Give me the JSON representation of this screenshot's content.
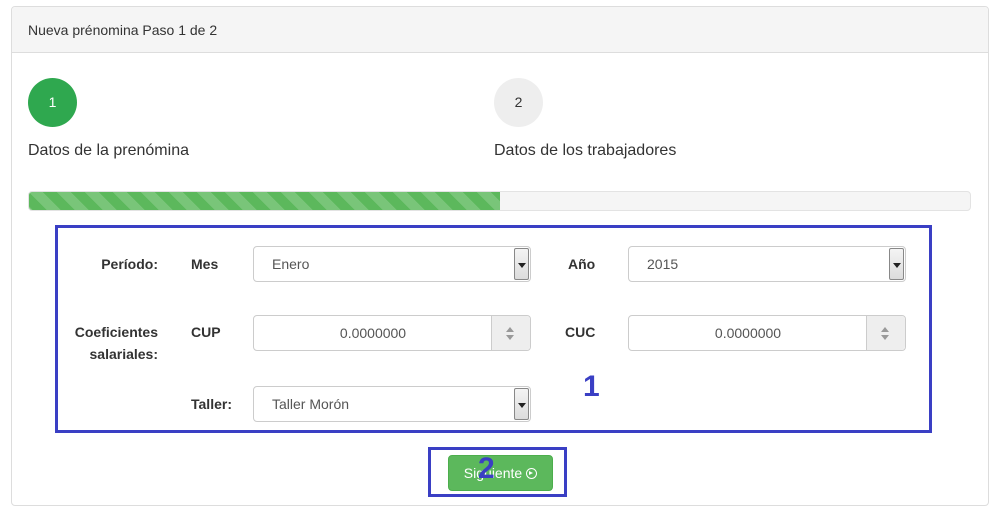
{
  "panel": {
    "title": "Nueva prénomina Paso 1 de 2"
  },
  "steps": [
    {
      "number": "1",
      "label": "Datos de la prenómina",
      "active": true
    },
    {
      "number": "2",
      "label": "Datos de los trabajadores",
      "active": false
    }
  ],
  "progress": {
    "percent": 50
  },
  "form": {
    "periodo_label": "Período:",
    "mes_label": "Mes",
    "mes_value": "Enero",
    "anio_label": "Año",
    "anio_value": "2015",
    "coef_label_line1": "Coeficientes",
    "coef_label_line2": "salariales:",
    "cup_label": "CUP",
    "cup_value": "0.0000000",
    "cuc_label": "CUC",
    "cuc_value": "0.0000000",
    "taller_label": "Taller:",
    "taller_value": "Taller Morón"
  },
  "annotations": {
    "box1": "1",
    "box2": "2"
  },
  "next_button": {
    "label": "Siguiente"
  },
  "colors": {
    "accent": "#5cb85c",
    "annotation": "#3a3fc4"
  }
}
